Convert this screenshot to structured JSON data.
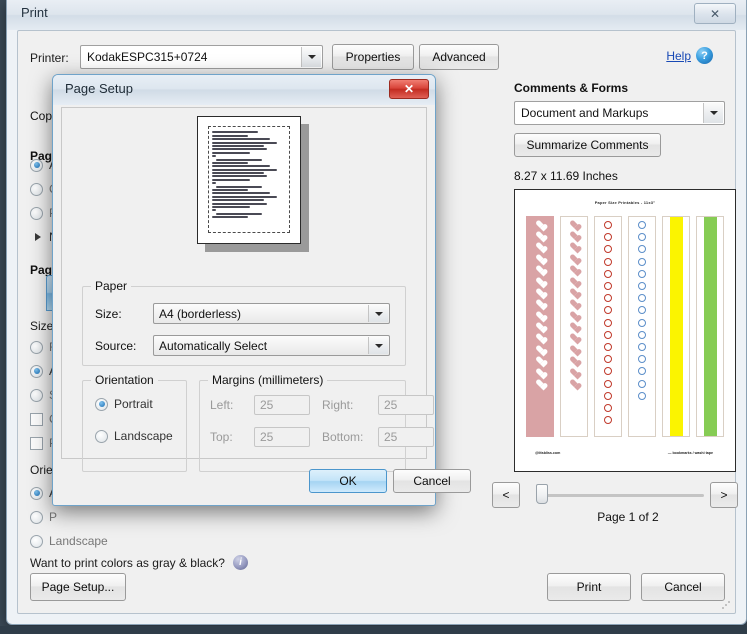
{
  "window": {
    "title": "Print",
    "close_label": "✕"
  },
  "printer": {
    "label": "Printer:",
    "value": "KodakESPC315+0724",
    "properties_label": "Properties",
    "advanced_label": "Advanced",
    "help_label": "Help",
    "help_icon": "question-mark-icon"
  },
  "left_panel": {
    "copies_label": "Copi",
    "pages_to_print_head": "Page",
    "pages_options": [
      {
        "label": "A",
        "selected": true
      },
      {
        "label": "C",
        "selected": false
      },
      {
        "label": "P",
        "selected": false
      }
    ],
    "more_options_label": "N",
    "page_sizing_head": "Page",
    "size_label": "Size",
    "size_options": [
      {
        "label": "Fi",
        "selected": false,
        "dim": true
      },
      {
        "label": "A",
        "selected": true,
        "dim": false
      },
      {
        "label": "Sl",
        "selected": false,
        "dim": true
      }
    ],
    "check_options": [
      {
        "label": "C",
        "checked": false
      },
      {
        "label": "P",
        "checked": false
      }
    ],
    "orientation_label": "Orier",
    "orientation_options": [
      {
        "label": "A",
        "selected": true,
        "dim": false
      },
      {
        "label": "P",
        "selected": false,
        "dim": true
      },
      {
        "label": "Landscape",
        "selected": false,
        "dim": true
      }
    ],
    "gray_question": "Want to print colors as gray & black?",
    "gray_icon": "info-icon"
  },
  "comments_forms": {
    "heading": "Comments & Forms",
    "selected": "Document and Markups",
    "summarize_label": "Summarize Comments",
    "paper_dimensions": "8.27 x 11.69 Inches"
  },
  "preview": {
    "title": "Paper Size Printables - 11x3\"",
    "footer_left": "@litsbliss.com",
    "footer_right": "— bookmarks / washi tape",
    "columns": [
      {
        "name": "pink-heart-filled-strip",
        "type": "hearts",
        "fill": "#d9a3a5",
        "heart_color": "#ffffff",
        "count": 15
      },
      {
        "name": "pink-heart-outline-strip",
        "type": "hearts",
        "fill": "#ffffff",
        "heart_color": "#d9a3a5",
        "count": 15
      },
      {
        "name": "red-circle-strip",
        "type": "circles",
        "fill": "#ffffff",
        "circle_color": "#c0392b",
        "count": 17
      },
      {
        "name": "blue-circle-strip",
        "type": "circles",
        "fill": "#ffffff",
        "circle_color": "#5b8ec9",
        "count": 15
      },
      {
        "name": "yellow-bar-strip",
        "type": "bar",
        "fill": "#ffffff",
        "bar_color": "#fbf400"
      },
      {
        "name": "green-bar-strip",
        "type": "bar",
        "fill": "#ffffff",
        "bar_color": "#86cc54"
      }
    ]
  },
  "navigation": {
    "prev_label": "<",
    "next_label": ">",
    "page_count_label": "Page 1 of 2",
    "slider_value": 0
  },
  "footer": {
    "page_setup_label": "Page Setup...",
    "print_label": "Print",
    "cancel_label": "Cancel"
  },
  "page_setup": {
    "title": "Page Setup",
    "close_label": "✕",
    "paper": {
      "legend": "Paper",
      "size_label": "Size:",
      "size_value": "A4 (borderless)",
      "source_label": "Source:",
      "source_value": "Automatically Select"
    },
    "orientation": {
      "legend": "Orientation",
      "portrait_label": "Portrait",
      "landscape_label": "Landscape",
      "selected": "Portrait"
    },
    "margins": {
      "legend": "Margins (millimeters)",
      "left_label": "Left:",
      "left_value": "25",
      "right_label": "Right:",
      "right_value": "25",
      "top_label": "Top:",
      "top_value": "25",
      "bottom_label": "Bottom:",
      "bottom_value": "25"
    },
    "ok_label": "OK",
    "cancel_label": "Cancel"
  }
}
